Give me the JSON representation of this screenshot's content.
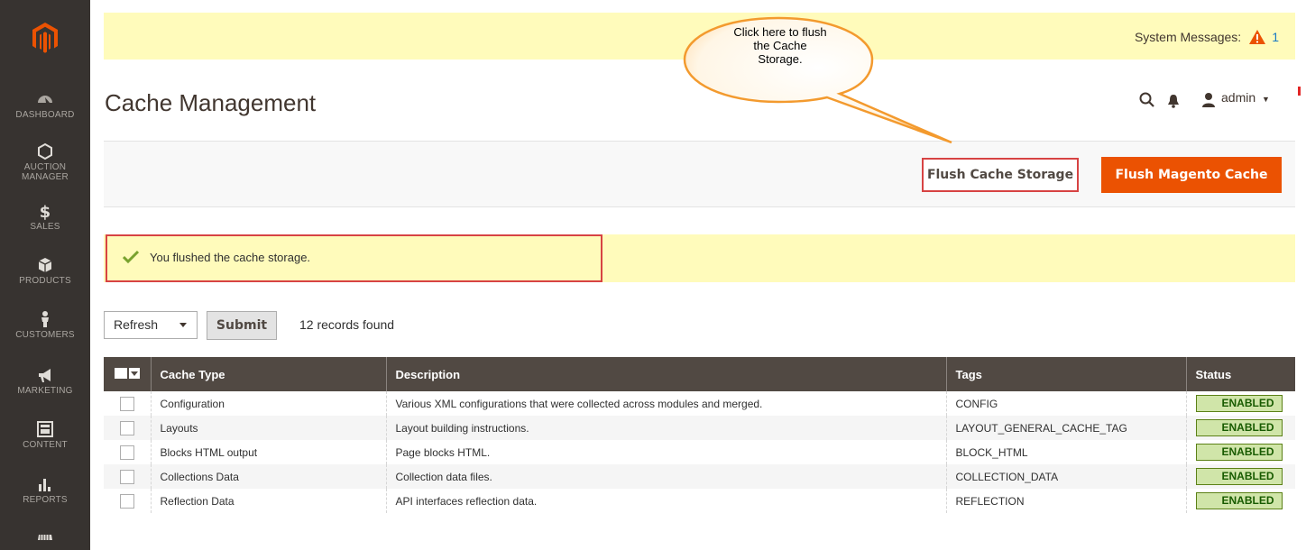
{
  "sidebar": {
    "items": [
      {
        "label": "DASHBOARD",
        "icon": "dashboard-icon"
      },
      {
        "label": "AUCTION MANAGER",
        "icon": "hexagon-icon"
      },
      {
        "label": "SALES",
        "icon": "dollar-icon"
      },
      {
        "label": "PRODUCTS",
        "icon": "box-icon"
      },
      {
        "label": "CUSTOMERS",
        "icon": "person-icon"
      },
      {
        "label": "MARKETING",
        "icon": "megaphone-icon"
      },
      {
        "label": "CONTENT",
        "icon": "layout-icon"
      },
      {
        "label": "REPORTS",
        "icon": "bar-chart-icon"
      },
      {
        "label": "",
        "icon": "store-icon"
      }
    ]
  },
  "system_messages": {
    "label": "System Messages:",
    "count": "1"
  },
  "header": {
    "title": "Cache Management",
    "user": "admin"
  },
  "callout": {
    "line1": "Click here to flush",
    "line2": "the Cache",
    "line3": "Storage."
  },
  "actions": {
    "flush_storage": "Flush Cache Storage",
    "flush_magento": "Flush Magento Cache"
  },
  "message": {
    "text": "You flushed the cache storage."
  },
  "mass_action": {
    "selected": "Refresh",
    "submit": "Submit",
    "records": "12 records found"
  },
  "table": {
    "columns": [
      "Cache Type",
      "Description",
      "Tags",
      "Status"
    ],
    "rows": [
      {
        "type": "Configuration",
        "description": "Various XML configurations that were collected across modules and merged.",
        "tags": "CONFIG",
        "status": "ENABLED"
      },
      {
        "type": "Layouts",
        "description": "Layout building instructions.",
        "tags": "LAYOUT_GENERAL_CACHE_TAG",
        "status": "ENABLED"
      },
      {
        "type": "Blocks HTML output",
        "description": "Page blocks HTML.",
        "tags": "BLOCK_HTML",
        "status": "ENABLED"
      },
      {
        "type": "Collections Data",
        "description": "Collection data files.",
        "tags": "COLLECTION_DATA",
        "status": "ENABLED"
      },
      {
        "type": "Reflection Data",
        "description": "API interfaces reflection data.",
        "tags": "REFLECTION",
        "status": "ENABLED"
      }
    ]
  },
  "colors": {
    "sidebar": "#373330",
    "accent": "#eb5202",
    "highlight": "#d74343",
    "notice": "#fffbbb",
    "table_header": "#514943"
  }
}
